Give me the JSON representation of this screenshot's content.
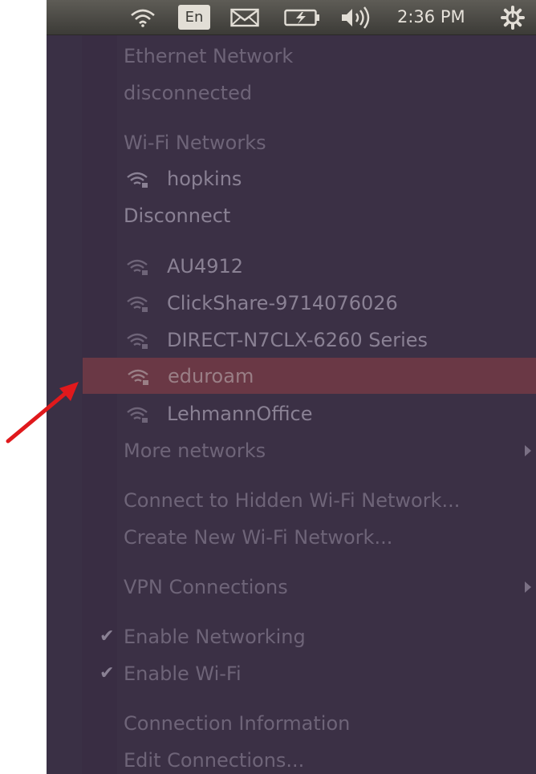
{
  "top_panel": {
    "keyboard_layout": "En",
    "time": "2:36 PM",
    "icons": [
      "wifi-icon",
      "keyboard-layout-indicator",
      "mail-icon",
      "battery-icon",
      "volume-icon",
      "settings-gear-icon"
    ]
  },
  "menu": {
    "ethernet_header": "Ethernet Network",
    "ethernet_status": "disconnected",
    "wifi_header": "Wi-Fi Networks",
    "connected_network": "hopkins",
    "disconnect": "Disconnect",
    "networks": [
      "AU4912",
      "ClickShare-9714076026",
      "DIRECT-N7CLX-6260 Series",
      "eduroam",
      "LehmannOffice"
    ],
    "more_networks": "More networks",
    "hidden_network": "Connect to Hidden Wi-Fi Network...",
    "create_network": "Create New Wi-Fi Network...",
    "vpn": "VPN Connections",
    "enable_networking": "Enable Networking",
    "enable_wifi": "Enable Wi-Fi",
    "connection_info": "Connection Information",
    "edit_connections": "Edit Connections..."
  },
  "colors": {
    "highlight": "#6a3845",
    "menu_bg": "#3b3045",
    "pointer": "#e0191c"
  }
}
